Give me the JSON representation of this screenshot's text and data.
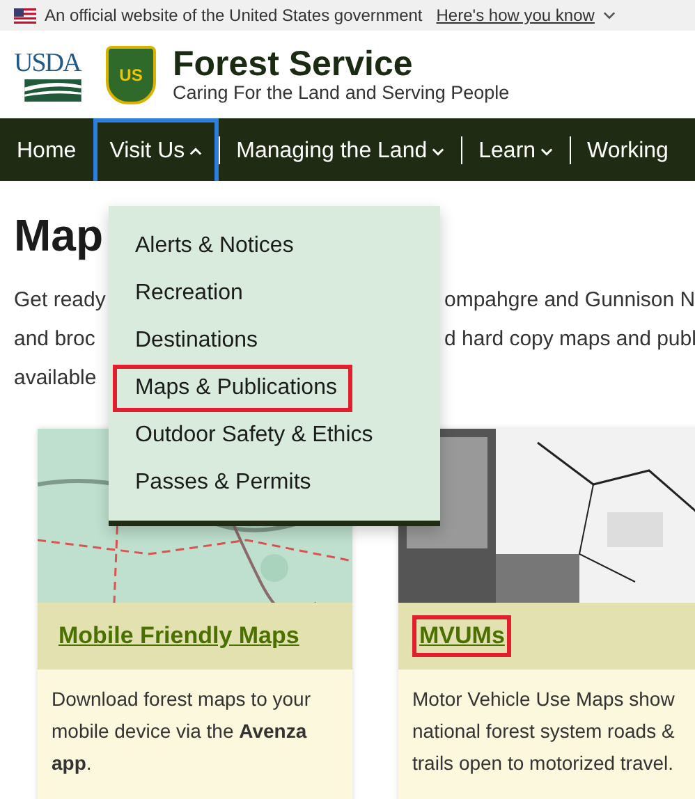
{
  "gov_banner": {
    "text": "An official website of the United States government",
    "link": "Here's how you know"
  },
  "header": {
    "agency": "USDA",
    "emblem": "US",
    "title": "Forest Service",
    "tagline": "Caring For the Land and Serving People"
  },
  "nav": [
    {
      "label": "Home",
      "has_menu": false,
      "expanded": false
    },
    {
      "label": "Visit Us",
      "has_menu": true,
      "expanded": true
    },
    {
      "label": "Managing the Land",
      "has_menu": true,
      "expanded": false
    },
    {
      "label": "Learn",
      "has_menu": true,
      "expanded": false
    },
    {
      "label": "Working",
      "has_menu": false,
      "expanded": false
    }
  ],
  "dropdown": [
    {
      "label": "Alerts & Notices",
      "highlighted": false
    },
    {
      "label": "Recreation",
      "highlighted": false
    },
    {
      "label": "Destinations",
      "highlighted": false
    },
    {
      "label": "Maps & Publications",
      "highlighted": true
    },
    {
      "label": "Outdoor Safety & Ethics",
      "highlighted": false
    },
    {
      "label": "Passes & Permits",
      "highlighted": false
    }
  ],
  "heading": "Map",
  "intro_lines": [
    {
      "left": "Get ready",
      "right": "ompahgre and Gunnison N"
    },
    {
      "left": "and broc",
      "right": "d hard copy maps and publ"
    },
    {
      "left": "available"
    }
  ],
  "cards": [
    {
      "title": "Mobile Friendly Maps",
      "highlighted": false,
      "text": "Download forest maps to your mobile device via the **Avenza app**."
    },
    {
      "title": "MVUMs",
      "highlighted": true,
      "text": "Motor Vehicle Use Maps show national forest system roads & trails open to motorized travel."
    }
  ]
}
